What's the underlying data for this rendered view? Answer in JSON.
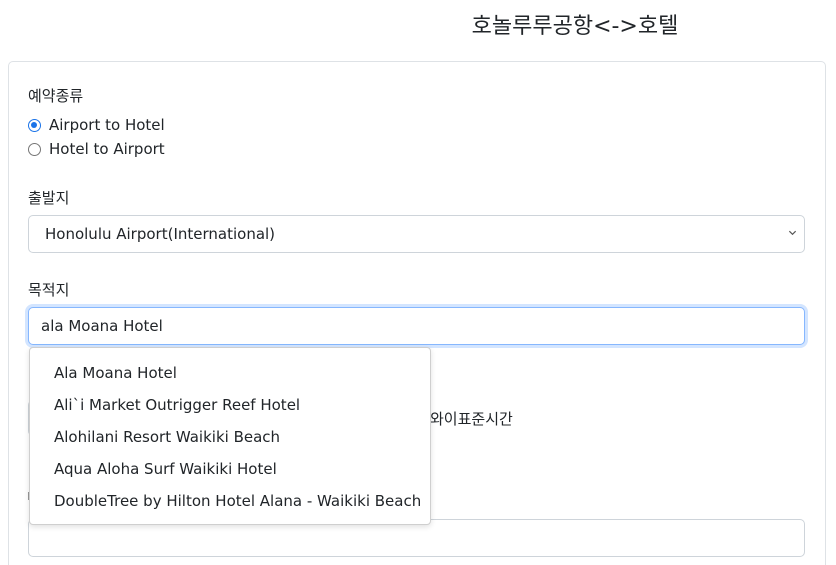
{
  "header": {
    "title": "호놀루루공항<->호텔"
  },
  "form": {
    "reservation_type": {
      "label": "예약종류",
      "options": [
        {
          "label": "Airport to Hotel",
          "checked": true
        },
        {
          "label": "Hotel to Airport",
          "checked": false
        }
      ]
    },
    "origin": {
      "label": "출발지",
      "selected": "Honolulu Airport(International)"
    },
    "destination": {
      "label": "목적지",
      "value": "ala Moana Hotel"
    },
    "time_note": "와이표준시간",
    "autocomplete": [
      "Ala Moana Hotel",
      "Ali`i Market Outrigger Reef Hotel",
      "Alohilani Resort Waikiki Beach",
      "Aqua Aloha Surf Waikiki Hotel",
      "DoubleTree by Hilton Hotel Alana - Waikiki Beach"
    ]
  },
  "colors": {
    "accent": "#1a73e8",
    "focus_border": "#86b7fe",
    "border": "#ced4da"
  }
}
